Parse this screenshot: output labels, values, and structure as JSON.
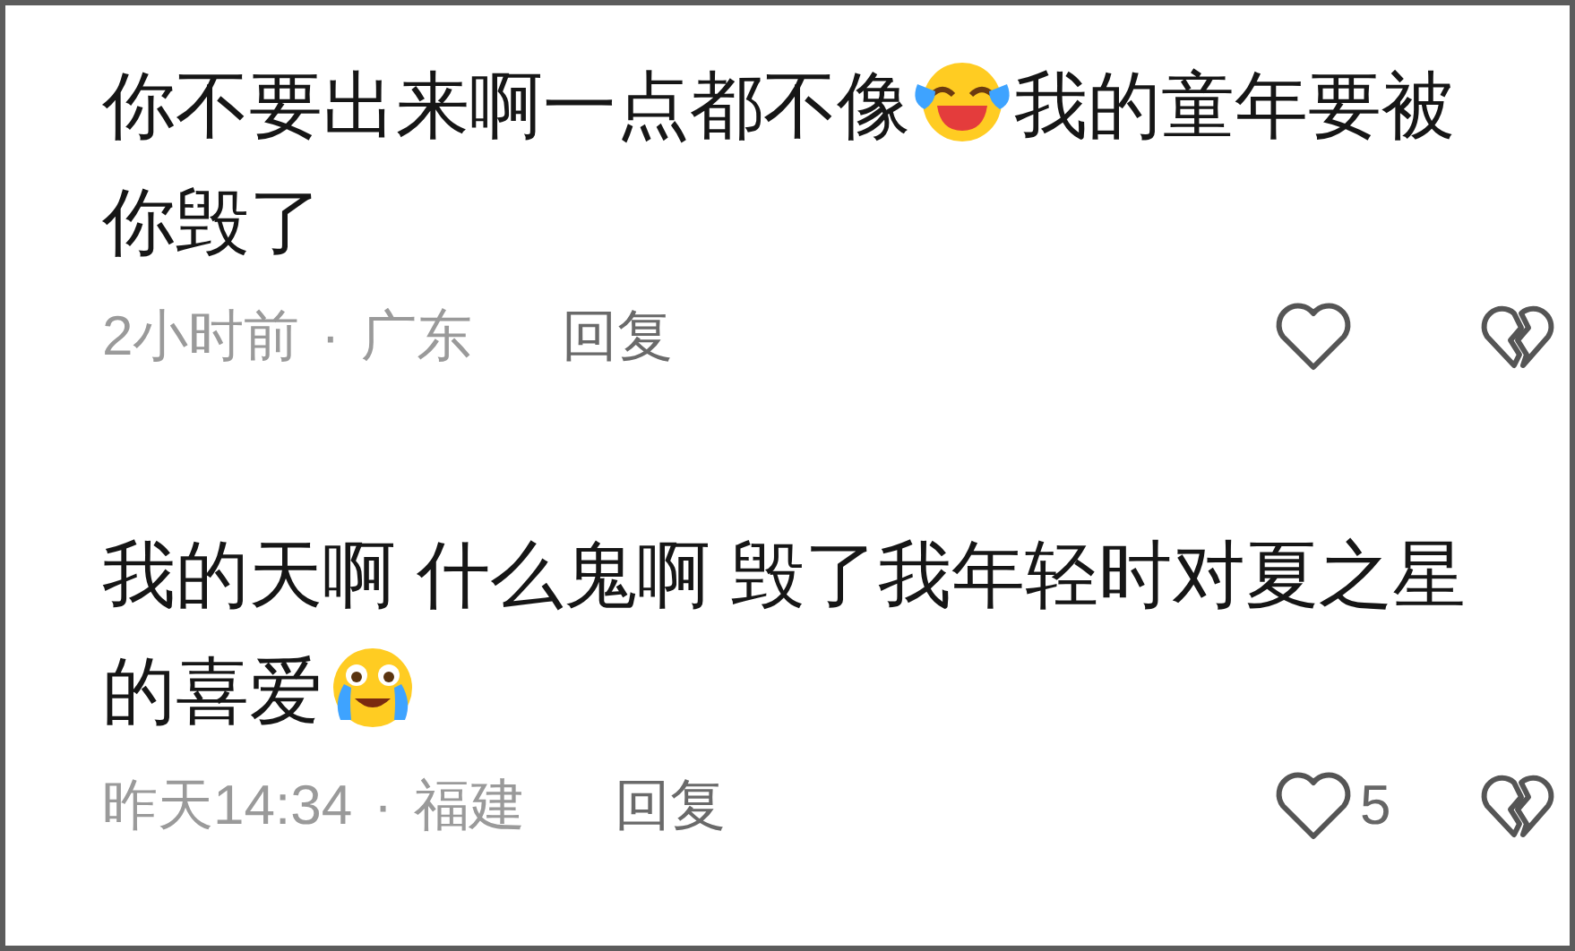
{
  "comments": [
    {
      "parts": [
        {
          "kind": "text",
          "text": "你不要出来啊一点都不像"
        },
        {
          "kind": "laughing_emoji"
        },
        {
          "kind": "text",
          "text": "我的童年要被你毁了"
        }
      ],
      "time": "2小时前",
      "dot": "·",
      "location": "广东",
      "reply": "回复"
    },
    {
      "parts": [
        {
          "kind": "text",
          "text": "我的天啊 什么鬼啊 毁了我年轻时对夏之星的喜爱"
        },
        {
          "kind": "teary_emoji"
        }
      ],
      "time": "昨天14:34",
      "dot": "·",
      "location": "福建",
      "reply": "回复",
      "likes": "5"
    }
  ]
}
